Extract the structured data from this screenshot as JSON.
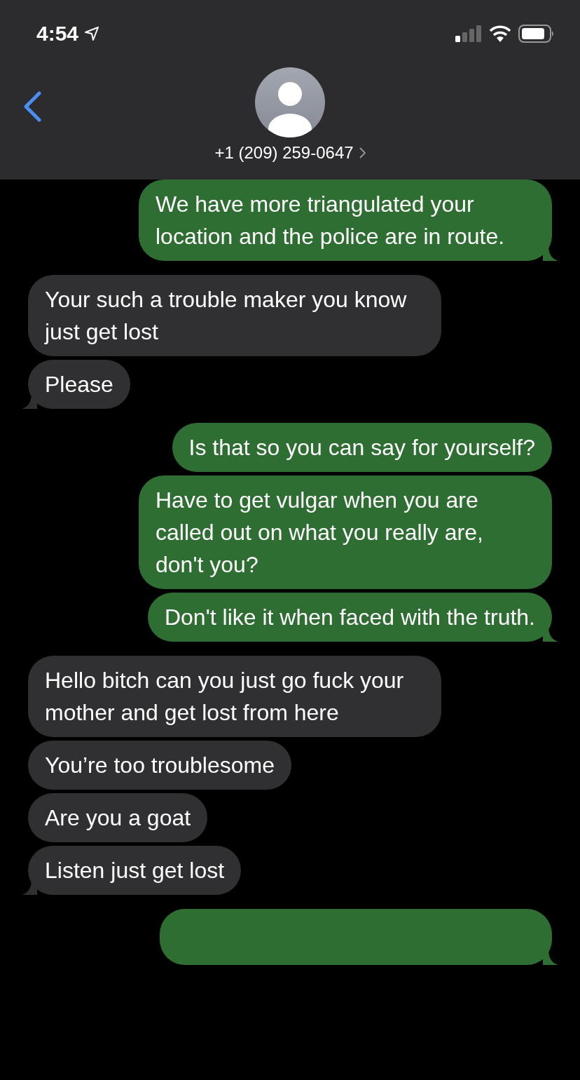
{
  "status_bar": {
    "time": "4:54"
  },
  "contact": {
    "name": "+1 (209) 259-0647"
  },
  "messages": [
    {
      "kind": "sent",
      "text": "We have more triangulated your location and the police are in route."
    },
    {
      "kind": "received",
      "text": "Your such a trouble maker you know just get lost"
    },
    {
      "kind": "received",
      "text": "Please"
    },
    {
      "kind": "sent",
      "text": "Is that so you can say for yourself?"
    },
    {
      "kind": "sent",
      "text": "Have to get vulgar when you are called out on what you really are, don't you?"
    },
    {
      "kind": "sent",
      "text": "Don't like it when faced with the truth."
    },
    {
      "kind": "received",
      "text": "Hello bitch can you just go fuck your mother and get lost from here"
    },
    {
      "kind": "received",
      "text": "You’re too troublesome"
    },
    {
      "kind": "received",
      "text": "Are you a goat"
    },
    {
      "kind": "received",
      "text": "Listen just get lost"
    },
    {
      "kind": "sent"
    }
  ]
}
